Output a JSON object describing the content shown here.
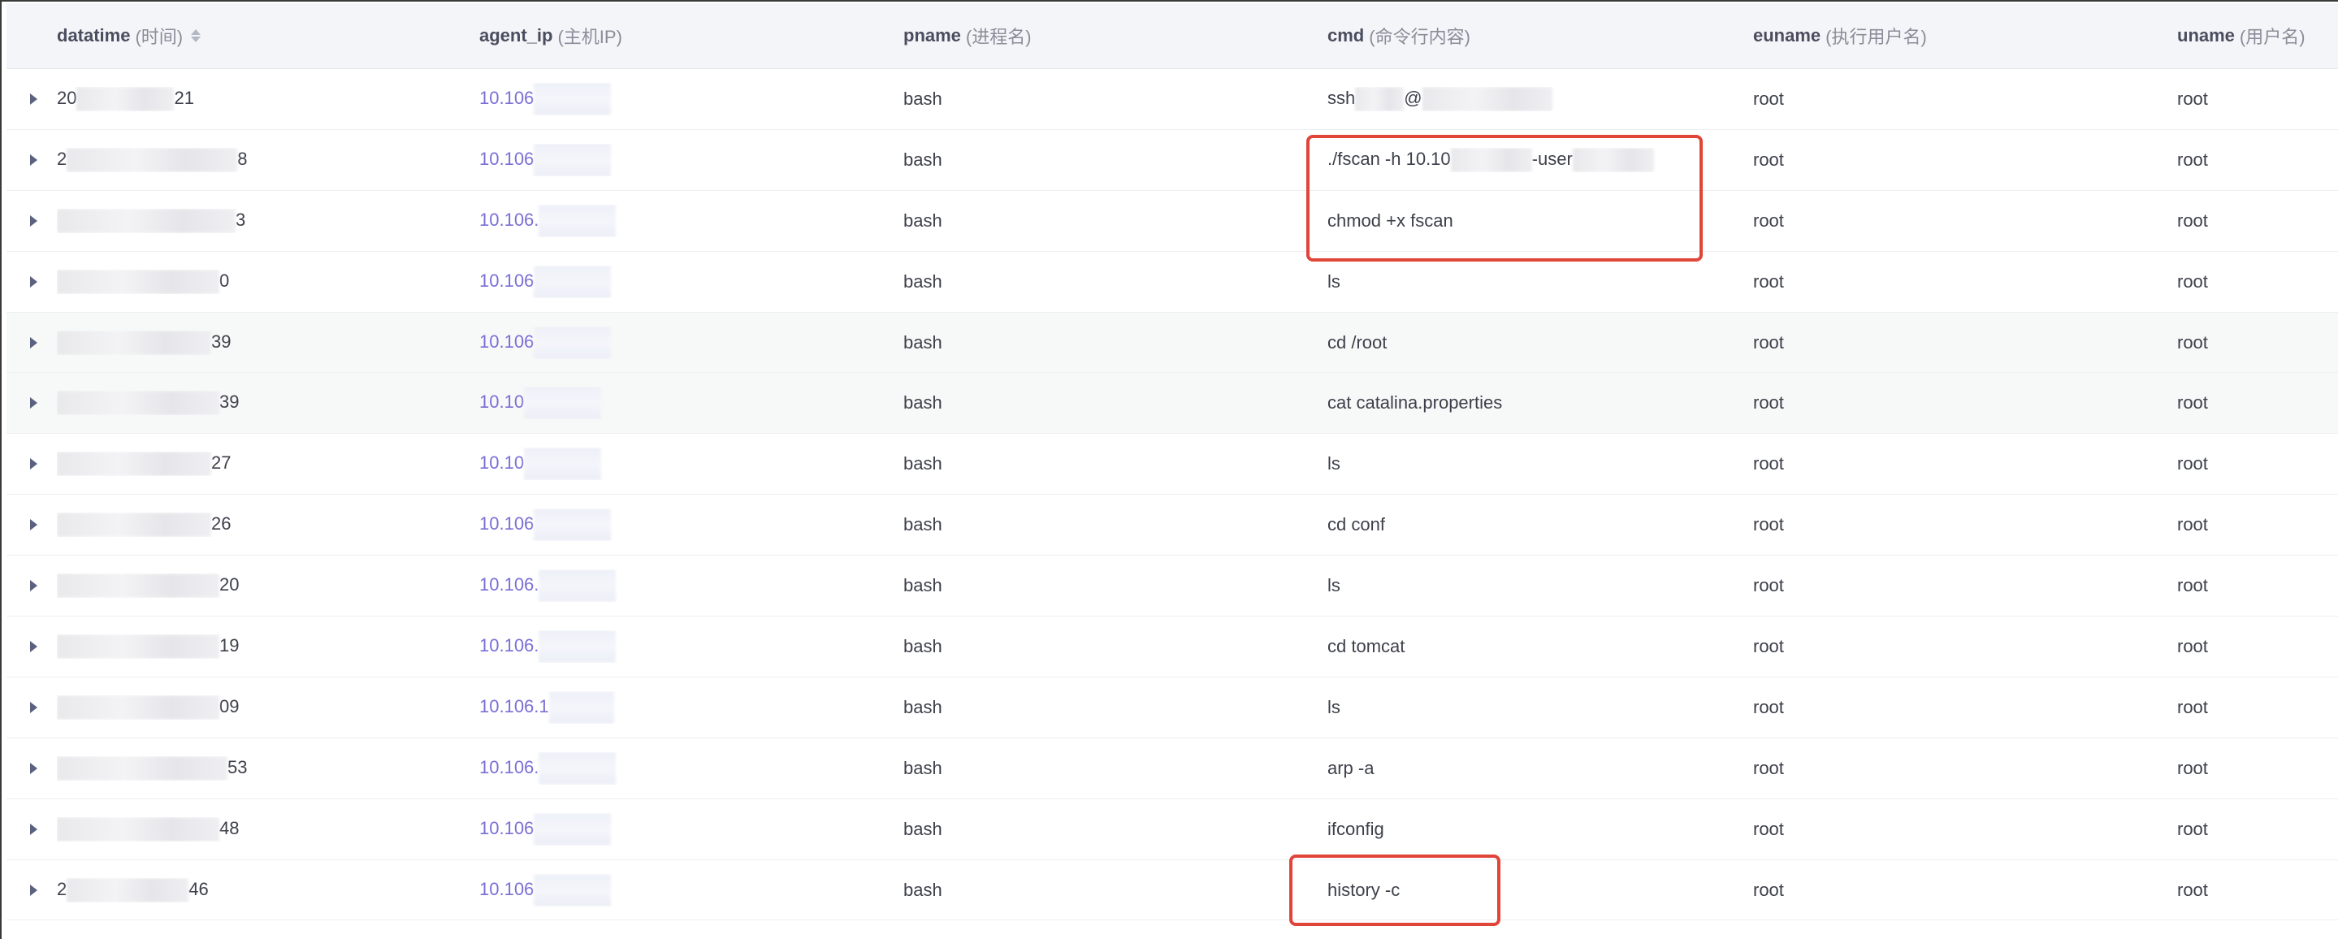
{
  "columns": {
    "datatime": {
      "en": "datatime",
      "zh": "(时间)"
    },
    "agent_ip": {
      "en": "agent_ip",
      "zh": "(主机IP)"
    },
    "pname": {
      "en": "pname",
      "zh": "(进程名)"
    },
    "cmd": {
      "en": "cmd",
      "zh": "(命令行内容)"
    },
    "euname": {
      "en": "euname",
      "zh": "(执行用户名)"
    },
    "uname": {
      "en": "uname",
      "zh": "(用户名)"
    }
  },
  "rows": [
    {
      "dt_prefix": "20",
      "dt_suffix": "21",
      "ip": "10.106",
      "pname": "bash",
      "cmd_a": "ssh",
      "cmd_mid": "@",
      "cmd_b": "",
      "euname": "root",
      "uname": "root"
    },
    {
      "dt_prefix": "2",
      "dt_suffix": "8",
      "ip": "10.106",
      "pname": "bash",
      "cmd_a": "./fscan -h 10.10",
      "cmd_mid": "-user",
      "cmd_b": "",
      "euname": "root",
      "uname": "root"
    },
    {
      "dt_prefix": "",
      "dt_suffix": "3",
      "ip": "10.106.",
      "pname": "bash",
      "cmd_a": "chmod +x fscan",
      "cmd_mid": "",
      "cmd_b": "",
      "euname": "root",
      "uname": "root"
    },
    {
      "dt_prefix": "",
      "dt_suffix": "0",
      "ip": "10.106",
      "pname": "bash",
      "cmd_a": "ls",
      "cmd_mid": "",
      "cmd_b": "",
      "euname": "root",
      "uname": "root"
    },
    {
      "dt_prefix": "",
      "dt_suffix": "39",
      "ip": "10.106",
      "pname": "bash",
      "cmd_a": "cd /root",
      "cmd_mid": "",
      "cmd_b": "",
      "euname": "root",
      "uname": "root"
    },
    {
      "dt_prefix": "",
      "dt_suffix": "39",
      "ip": "10.10",
      "pname": "bash",
      "cmd_a": "cat catalina.properties",
      "cmd_mid": "",
      "cmd_b": "",
      "euname": "root",
      "uname": "root"
    },
    {
      "dt_prefix": "",
      "dt_suffix": "27",
      "ip": "10.10",
      "pname": "bash",
      "cmd_a": "ls",
      "cmd_mid": "",
      "cmd_b": "",
      "euname": "root",
      "uname": "root"
    },
    {
      "dt_prefix": "",
      "dt_suffix": "26",
      "ip": "10.106",
      "pname": "bash",
      "cmd_a": "cd conf",
      "cmd_mid": "",
      "cmd_b": "",
      "euname": "root",
      "uname": "root"
    },
    {
      "dt_prefix": "",
      "dt_suffix": "20",
      "ip": "10.106.",
      "pname": "bash",
      "cmd_a": "ls",
      "cmd_mid": "",
      "cmd_b": "",
      "euname": "root",
      "uname": "root"
    },
    {
      "dt_prefix": "",
      "dt_suffix": "19",
      "ip": "10.106.",
      "pname": "bash",
      "cmd_a": "cd tomcat",
      "cmd_mid": "",
      "cmd_b": "",
      "euname": "root",
      "uname": "root"
    },
    {
      "dt_prefix": "",
      "dt_suffix": "09",
      "ip": "10.106.1",
      "pname": "bash",
      "cmd_a": "ls",
      "cmd_mid": "",
      "cmd_b": "",
      "euname": "root",
      "uname": "root"
    },
    {
      "dt_prefix": "",
      "dt_suffix": "53",
      "ip": "10.106.",
      "pname": "bash",
      "cmd_a": "arp -a",
      "cmd_mid": "",
      "cmd_b": "",
      "euname": "root",
      "uname": "root"
    },
    {
      "dt_prefix": "",
      "dt_suffix": "48",
      "ip": "10.106",
      "pname": "bash",
      "cmd_a": "ifconfig",
      "cmd_mid": "",
      "cmd_b": "",
      "euname": "root",
      "uname": "root"
    },
    {
      "dt_prefix": "2",
      "dt_suffix": "46",
      "ip": "10.106",
      "pname": "bash",
      "cmd_a": "history -c",
      "cmd_mid": "",
      "cmd_b": "",
      "euname": "root",
      "uname": "root"
    }
  ],
  "icons": {
    "sort": "sort-icon",
    "expand": "caret-right-icon"
  },
  "colors": {
    "ip_link": "#7a6fd6",
    "highlight": "#e0453a",
    "expand_icon": "#5b6180"
  }
}
